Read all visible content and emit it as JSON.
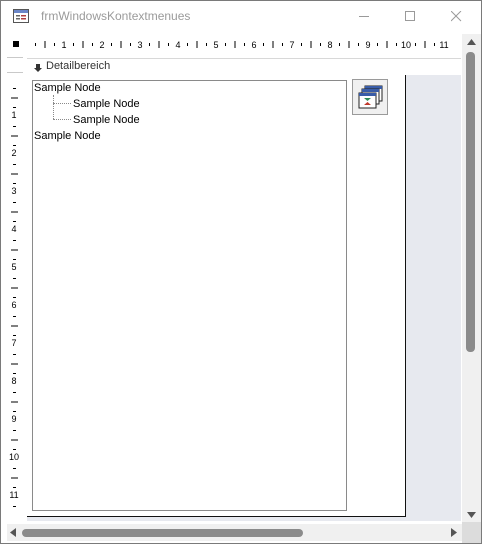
{
  "window": {
    "title": "frmWindowsKontextmenues",
    "icon": "form-icon",
    "controls": [
      "minimize",
      "maximize",
      "close"
    ]
  },
  "ruler": {
    "horizontal_numbers": [
      "1",
      "2",
      "3",
      "4",
      "5",
      "6",
      "7",
      "8",
      "9",
      "10",
      "11"
    ],
    "vertical_numbers": [
      "1",
      "2",
      "3",
      "4",
      "5",
      "6",
      "7",
      "8",
      "9",
      "10",
      "11"
    ]
  },
  "section": {
    "label": "Detailbereich"
  },
  "tree": {
    "nodes": [
      {
        "label": "Sample Node",
        "level": 0
      },
      {
        "label": "Sample Node",
        "level": 1
      },
      {
        "label": "Sample Node",
        "level": 1
      },
      {
        "label": "Sample Node",
        "level": 0
      }
    ]
  },
  "command_button": {
    "icon": "form-stack-icon"
  },
  "colors": {
    "design_background": "#e7e9ef",
    "scrollbar_thumb": "#8b8b8b",
    "title_text": "#9a9a9a"
  }
}
